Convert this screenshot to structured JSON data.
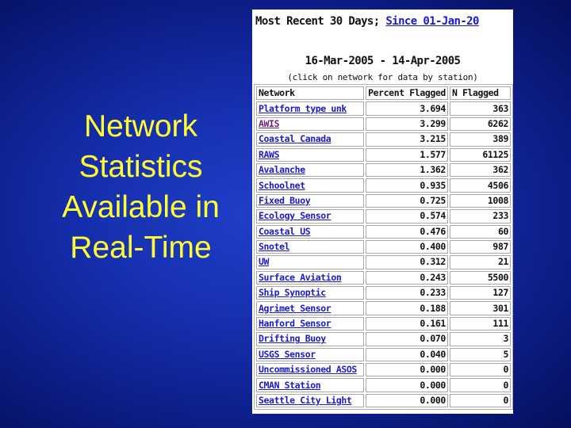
{
  "slide": {
    "title_lines": [
      "Network",
      "Statistics",
      "Available in",
      "Real-Time"
    ]
  },
  "panel": {
    "heading_text": "Most Recent 30 Days; ",
    "heading_link": "Since 01-Jan-20",
    "date_range": "16-Mar-2005 - 14-Apr-2005",
    "hint": "(click on network for data by station)",
    "columns": [
      "Network",
      "Percent Flagged",
      "N Flagged"
    ],
    "rows": [
      {
        "network": "Platform type unk",
        "percent": "3.694",
        "n": "363"
      },
      {
        "network": "AWIS",
        "percent": "3.299",
        "n": "6262"
      },
      {
        "network": "Coastal Canada",
        "percent": "3.215",
        "n": "389"
      },
      {
        "network": "RAWS",
        "percent": "1.577",
        "n": "61125"
      },
      {
        "network": "Avalanche",
        "percent": "1.362",
        "n": "362"
      },
      {
        "network": "Schoolnet",
        "percent": "0.935",
        "n": "4506"
      },
      {
        "network": "Fixed Buoy",
        "percent": "0.725",
        "n": "1008"
      },
      {
        "network": "Ecology Sensor",
        "percent": "0.574",
        "n": "233"
      },
      {
        "network": "Coastal US",
        "percent": "0.476",
        "n": "60"
      },
      {
        "network": "Snotel",
        "percent": "0.400",
        "n": "987"
      },
      {
        "network": "UW",
        "percent": "0.312",
        "n": "21"
      },
      {
        "network": "Surface Aviation",
        "percent": "0.243",
        "n": "5500"
      },
      {
        "network": "Ship Synoptic",
        "percent": "0.233",
        "n": "127"
      },
      {
        "network": "Agrimet Sensor",
        "percent": "0.188",
        "n": "301"
      },
      {
        "network": "Hanford Sensor",
        "percent": "0.161",
        "n": "111"
      },
      {
        "network": "Drifting Buoy",
        "percent": "0.070",
        "n": "3"
      },
      {
        "network": "USGS Sensor",
        "percent": "0.040",
        "n": "5"
      },
      {
        "network": "Uncommissioned ASOS",
        "percent": "0.000",
        "n": "0"
      },
      {
        "network": "CMAN Station",
        "percent": "0.000",
        "n": "0"
      },
      {
        "network": "Seattle City Light",
        "percent": "0.000",
        "n": "0"
      }
    ]
  },
  "colors": {
    "title_text": "#ffff33",
    "link": "#1a1acc",
    "visited_link": "#6b1f7a",
    "background": "#1630b0"
  }
}
